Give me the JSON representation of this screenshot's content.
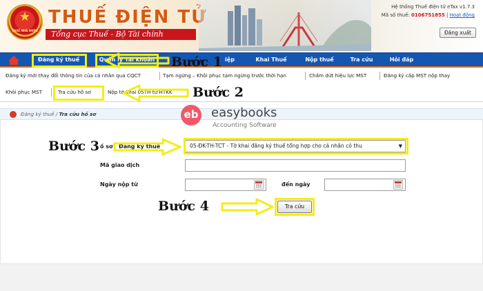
{
  "header": {
    "brand_title": "THUẾ ĐIỆN TỬ",
    "brand_subtitle": "Tổng cục Thuế - Bộ Tài chính",
    "emblem_text": "THUẾ NHÀ NƯỚC",
    "system_version": "Hệ thống Thuế điện tử eTax v1.7.3",
    "tax_id_label": "Mã số thuế:",
    "tax_id_value": "0106751855",
    "help_link": "Hoạt động",
    "logout_label": "Đăng xuất"
  },
  "main_nav": {
    "items": [
      {
        "label": "Đăng ký thuế"
      },
      {
        "label": "Quản lý Tài khoản"
      },
      {
        "label": "iệp"
      },
      {
        "label": "Khai Thuế"
      },
      {
        "label": "Nộp thuế"
      },
      {
        "label": "Tra cứu"
      },
      {
        "label": "Hỏi đáp"
      }
    ]
  },
  "sub_nav": {
    "row1": [
      {
        "label": "Đăng ký mới thay đổi thông tin của cá nhân qua CQCT"
      },
      {
        "label": "Tạm ngừng – Khôi phục tạm ngừng trước thời hạn"
      },
      {
        "label": "Chấm dứt hiệu lực MST"
      },
      {
        "label": "Đăng ký cấp MST nộp thay"
      }
    ],
    "row2": [
      {
        "label": "Khôi phục MST"
      },
      {
        "label": "Tra cứu hồ sơ"
      },
      {
        "label": "Nộp tờ khai 05TH từ HTKK"
      }
    ]
  },
  "breadcrumb": {
    "parent": "Đăng ký thuế",
    "separator": "/",
    "current": "Tra cứu hồ sơ"
  },
  "watermark": {
    "mark": "eb",
    "name": "easybooks",
    "tagline": "Accounting Software"
  },
  "form": {
    "type_label": "ồ sơ",
    "type_label_highlighted": "Đăng ký thuế",
    "type_selected": "05-ĐK-TH-TCT - Tờ khai đăng ký thuế tổng hợp cho cá nhân có thu",
    "transaction_label": "Mã giao dịch",
    "transaction_value": "",
    "from_date_label": "Ngày nộp từ",
    "from_date_value": "",
    "to_date_label": "đến ngày",
    "to_date_value": "",
    "submit_label": "Tra cứu"
  },
  "annotations": {
    "step1": "Bước 1",
    "step2": "Bước 2",
    "step3": "Bước 3",
    "step4": "Bước 4",
    "highlight_color": "#f4ec17"
  },
  "colors": {
    "nav_bg": "#1457b3",
    "nav_accent": "#e56b14",
    "brand_red": "#c8161d",
    "brand_orange": "#d65a12"
  }
}
